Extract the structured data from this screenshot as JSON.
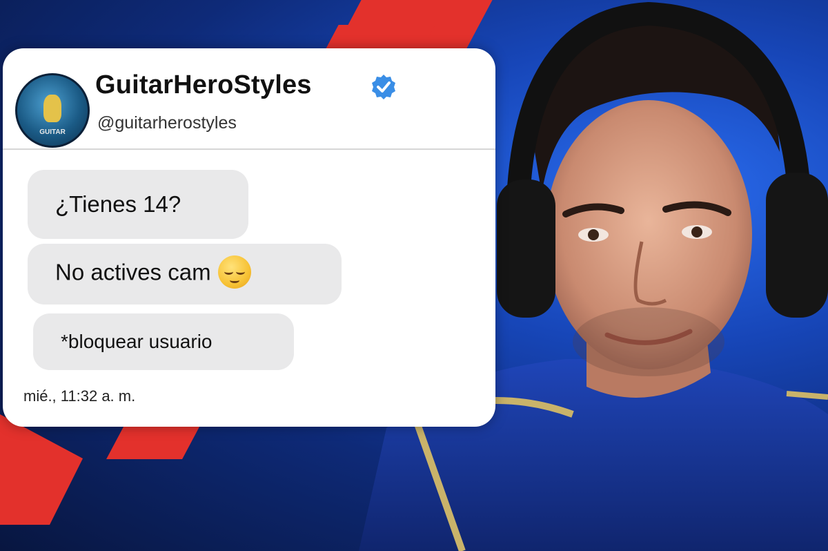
{
  "card": {
    "display_name": "GuitarHeroStyles",
    "handle": "@guitarherostyles",
    "avatar_text": "GUITAR",
    "messages": [
      "¿Tienes 14?",
      "No actives cam",
      "*bloquear usuario"
    ],
    "timestamp": "mié., 11:32 a. m."
  },
  "icons": {
    "verified": "verified-badge-icon",
    "emoji": "relieved-face-emoji-icon"
  },
  "colors": {
    "accent_blue": "#3a8ee6",
    "streak_red": "#e3312c",
    "bubble_gray": "#e9e9ea"
  }
}
